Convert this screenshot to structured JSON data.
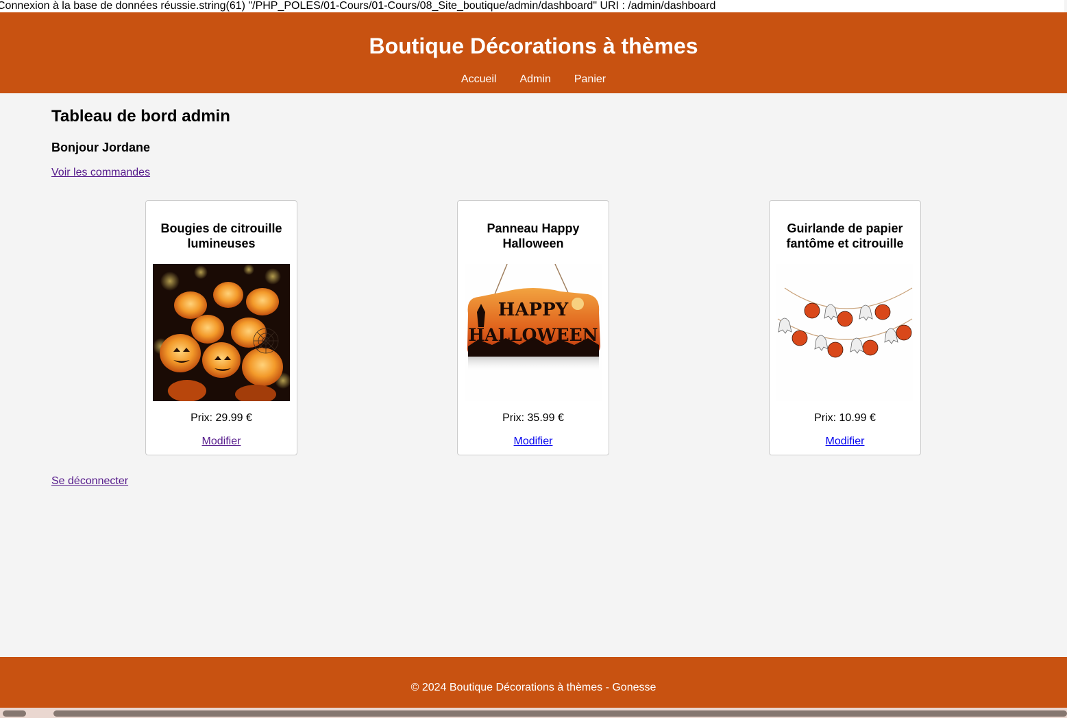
{
  "debug": {
    "text": "Connexion à la base de données réussie.string(61) \"/PHP_POLES/01-Cours/01-Cours/08_Site_boutique/admin/dashboard\" URI : /admin/dashboard"
  },
  "header": {
    "title": "Boutique Décorations à thèmes",
    "nav": [
      "Accueil",
      "Admin",
      "Panier"
    ]
  },
  "main": {
    "title": "Tableau de bord admin",
    "greeting": "Bonjour Jordane",
    "orders_link": "Voir les commandes",
    "logout_link": "Se déconnecter"
  },
  "products": [
    {
      "name": "Bougies de citrouille lumineuses",
      "price": "Prix: 29.99 €",
      "edit_label": "Modifier",
      "image": "pumpkin-candles-photo"
    },
    {
      "name": "Panneau Happy Halloween",
      "price": "Prix: 35.99 €",
      "edit_label": "Modifier",
      "image": "happy-halloween-sign-photo",
      "sign_text_1": "HAPPY",
      "sign_text_2": "HALLOWEEN"
    },
    {
      "name": "Guirlande de papier fantôme et citrouille",
      "price": "Prix: 10.99 €",
      "edit_label": "Modifier",
      "image": "ghost-pumpkin-garland-photo"
    }
  ],
  "footer": {
    "text": "© 2024 Boutique Décorations à thèmes - Gonesse"
  },
  "colors": {
    "brand": "#c85211",
    "background": "#f4f4f4",
    "link_visited": "#551a8b",
    "link": "#0000ee"
  }
}
